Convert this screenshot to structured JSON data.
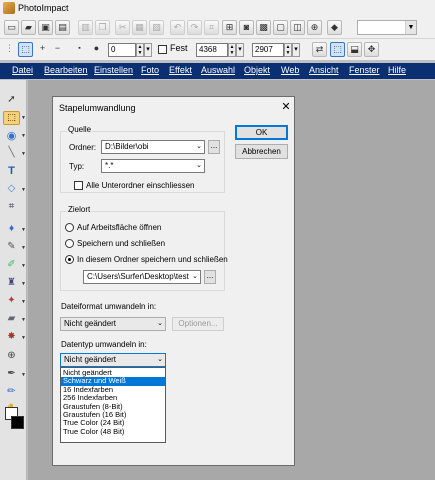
{
  "app": {
    "title": "PhotoImpact"
  },
  "toolbar2": {
    "value_a": "0",
    "fest_label": "Fest",
    "width_value": "4368",
    "height_value": "2907"
  },
  "menu": [
    "Datei",
    "Bearbeiten",
    "Einstellen",
    "Foto",
    "Effekt",
    "Auswahl",
    "Objekt",
    "Web",
    "Ansicht",
    "Fenster",
    "Hilfe"
  ],
  "dialog": {
    "title": "Stapelumwandlung",
    "close_glyph": "✕",
    "ok_label": "OK",
    "cancel_label": "Abbrechen",
    "source": {
      "group_label": "Quelle",
      "folder_label": "Ordner:",
      "folder_value": "D:\\Bilder\\obi",
      "type_label": "Typ:",
      "type_value": "*.*",
      "browse_label": "...",
      "include_subfolders_label": "Alle Unterordner einschliessen",
      "include_subfolders_checked": false
    },
    "target": {
      "group_label": "Zielort",
      "options": [
        "Auf Arbeitsfläche öffnen",
        "Speichern und schließen",
        "In diesem Ordner speichern und schließen"
      ],
      "selected_index": 2,
      "folder_value": "C:\\Users\\Surfer\\Desktop\\test",
      "browse_label": "..."
    },
    "format": {
      "label": "Dateiformat umwandeln in:",
      "value": "Nicht geändert",
      "options_button": "Optionen..."
    },
    "datatype": {
      "label": "Datentyp umwandeln in:",
      "value": "Nicht geändert",
      "options": [
        "Nicht geändert",
        "Schwarz und Weiß",
        "16 Indexfarben",
        "256 Indexfarben",
        "Graustufen (8-Bit)",
        "Graustufen (16 Bit)",
        "True Color (24 Bit)",
        "True Color (48 Bit)"
      ],
      "highlighted_index": 1
    }
  },
  "colors": {
    "menubar": "#0a2f72",
    "selection": "#0078d7",
    "workspace": "#a8a8a8"
  }
}
